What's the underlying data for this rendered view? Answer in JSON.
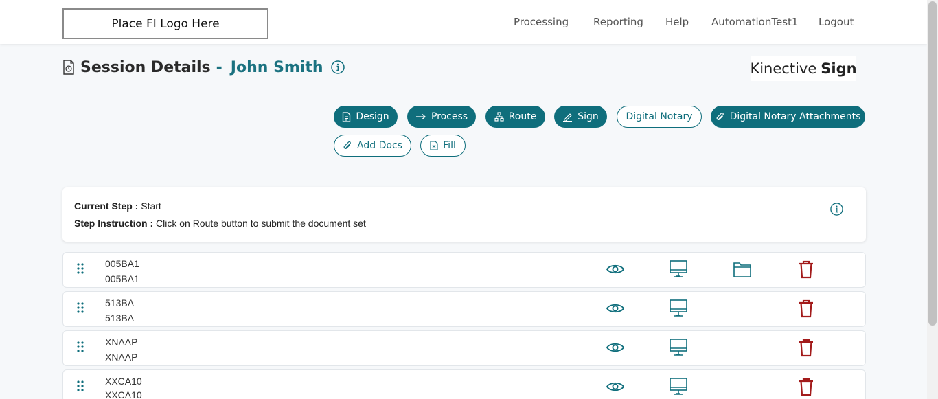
{
  "header": {
    "logo_text": "Place FI Logo Here",
    "nav": [
      "Processing",
      "Reporting",
      "Help",
      "AutomationTest1",
      "Logout"
    ]
  },
  "page": {
    "title": "Session Details",
    "dash": "-",
    "client_name": "John Smith",
    "brand_light": "Kinective",
    "brand_bold": "Sign"
  },
  "actions": {
    "design": "Design",
    "process": "Process",
    "route": "Route",
    "sign": "Sign",
    "digital_notary": "Digital Notary",
    "digital_notary_attachments": "Digital Notary Attachments",
    "add_docs": "Add Docs",
    "fill": "Fill"
  },
  "step": {
    "current_label": "Current Step :",
    "current_value": "Start",
    "instruction_label": "Step Instruction :",
    "instruction_value": "Click on Route button to submit the document set"
  },
  "documents": [
    {
      "code": "005BA1",
      "name": "005BA1",
      "has_folder": true
    },
    {
      "code": "513BA",
      "name": "513BA",
      "has_folder": false
    },
    {
      "code": "XNAAP",
      "name": "XNAAP",
      "has_folder": false
    },
    {
      "code": "XXCA10",
      "name": "XXCA10",
      "has_folder": false
    }
  ],
  "colors": {
    "accent": "#0f6e7c",
    "delete": "#a31b1b",
    "background": "#f6f8fa"
  },
  "icons": {
    "view": "eye-icon",
    "preview": "monitor-icon",
    "folder": "folder-icon",
    "delete": "trash-icon",
    "drag": "drag-handle-icon",
    "info": "info-icon"
  }
}
